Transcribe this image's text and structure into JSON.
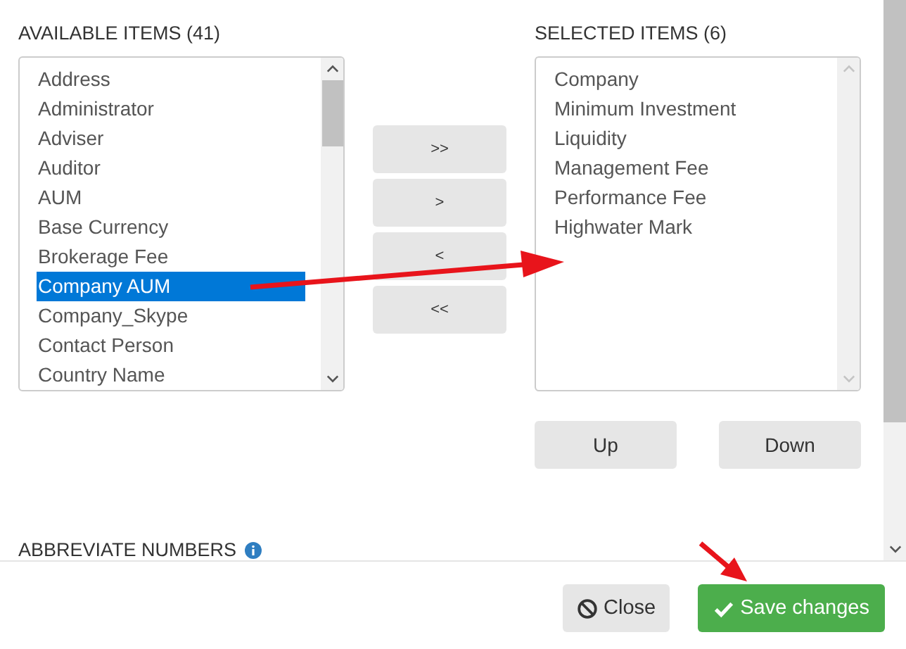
{
  "available": {
    "title": "AVAILABLE ITEMS (41)",
    "items": [
      {
        "label": "Address",
        "selected": false
      },
      {
        "label": "Administrator",
        "selected": false
      },
      {
        "label": "Adviser",
        "selected": false
      },
      {
        "label": "Auditor",
        "selected": false
      },
      {
        "label": "AUM",
        "selected": false
      },
      {
        "label": "Base Currency",
        "selected": false
      },
      {
        "label": "Brokerage Fee",
        "selected": false
      },
      {
        "label": "Company AUM",
        "selected": true
      },
      {
        "label": "Company_Skype",
        "selected": false
      },
      {
        "label": "Contact Person",
        "selected": false
      },
      {
        "label": "Country Name",
        "selected": false
      }
    ]
  },
  "move_buttons": [
    ">>",
    ">",
    "<",
    "<<"
  ],
  "selected_list": {
    "title": "SELECTED ITEMS (6)",
    "items": [
      {
        "label": "Company",
        "selected": false
      },
      {
        "label": "Minimum Investment",
        "selected": false
      },
      {
        "label": "Liquidity",
        "selected": false
      },
      {
        "label": "Management Fee",
        "selected": false
      },
      {
        "label": "Performance Fee",
        "selected": false
      },
      {
        "label": "Highwater Mark",
        "selected": false
      }
    ]
  },
  "order_buttons": [
    "Up",
    "Down"
  ],
  "section_heading": "ABBREVIATE NUMBERS",
  "footer": {
    "close": "Close",
    "save": "Save changes"
  }
}
